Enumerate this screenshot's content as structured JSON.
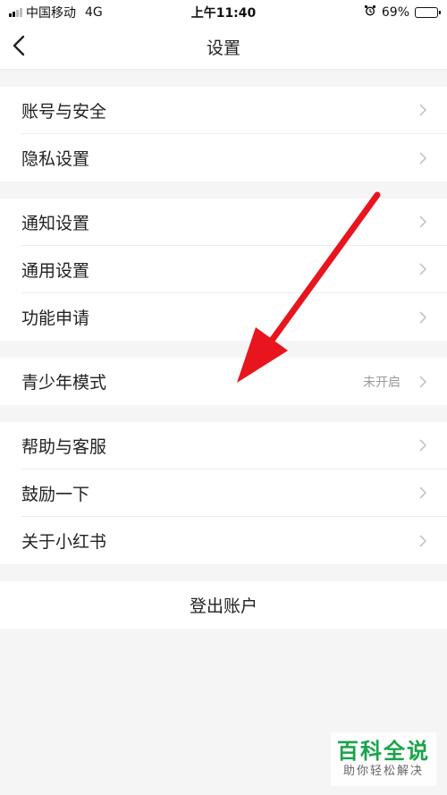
{
  "status_bar": {
    "carrier": "中国移动",
    "network": "4G",
    "time": "上午11:40",
    "battery_percent": "69%",
    "battery_level": 0.69,
    "alarm_icon": "alarm-clock-icon"
  },
  "nav": {
    "title": "设置",
    "back_icon": "chevron-left-icon"
  },
  "groups": [
    {
      "items": [
        {
          "label": "账号与安全"
        },
        {
          "label": "隐私设置"
        }
      ]
    },
    {
      "items": [
        {
          "label": "通知设置"
        },
        {
          "label": "通用设置"
        },
        {
          "label": "功能申请"
        }
      ]
    },
    {
      "items": [
        {
          "label": "青少年模式",
          "value": "未开启"
        }
      ]
    },
    {
      "items": [
        {
          "label": "帮助与客服"
        },
        {
          "label": "鼓励一下"
        },
        {
          "label": "关于小红书"
        }
      ]
    }
  ],
  "logout_label": "登出账户",
  "annotation": {
    "arrow_color": "#e8141e"
  },
  "watermark": {
    "title": "百科全说",
    "subtitle": "助你轻松解决",
    "color": "#1aa34a"
  }
}
